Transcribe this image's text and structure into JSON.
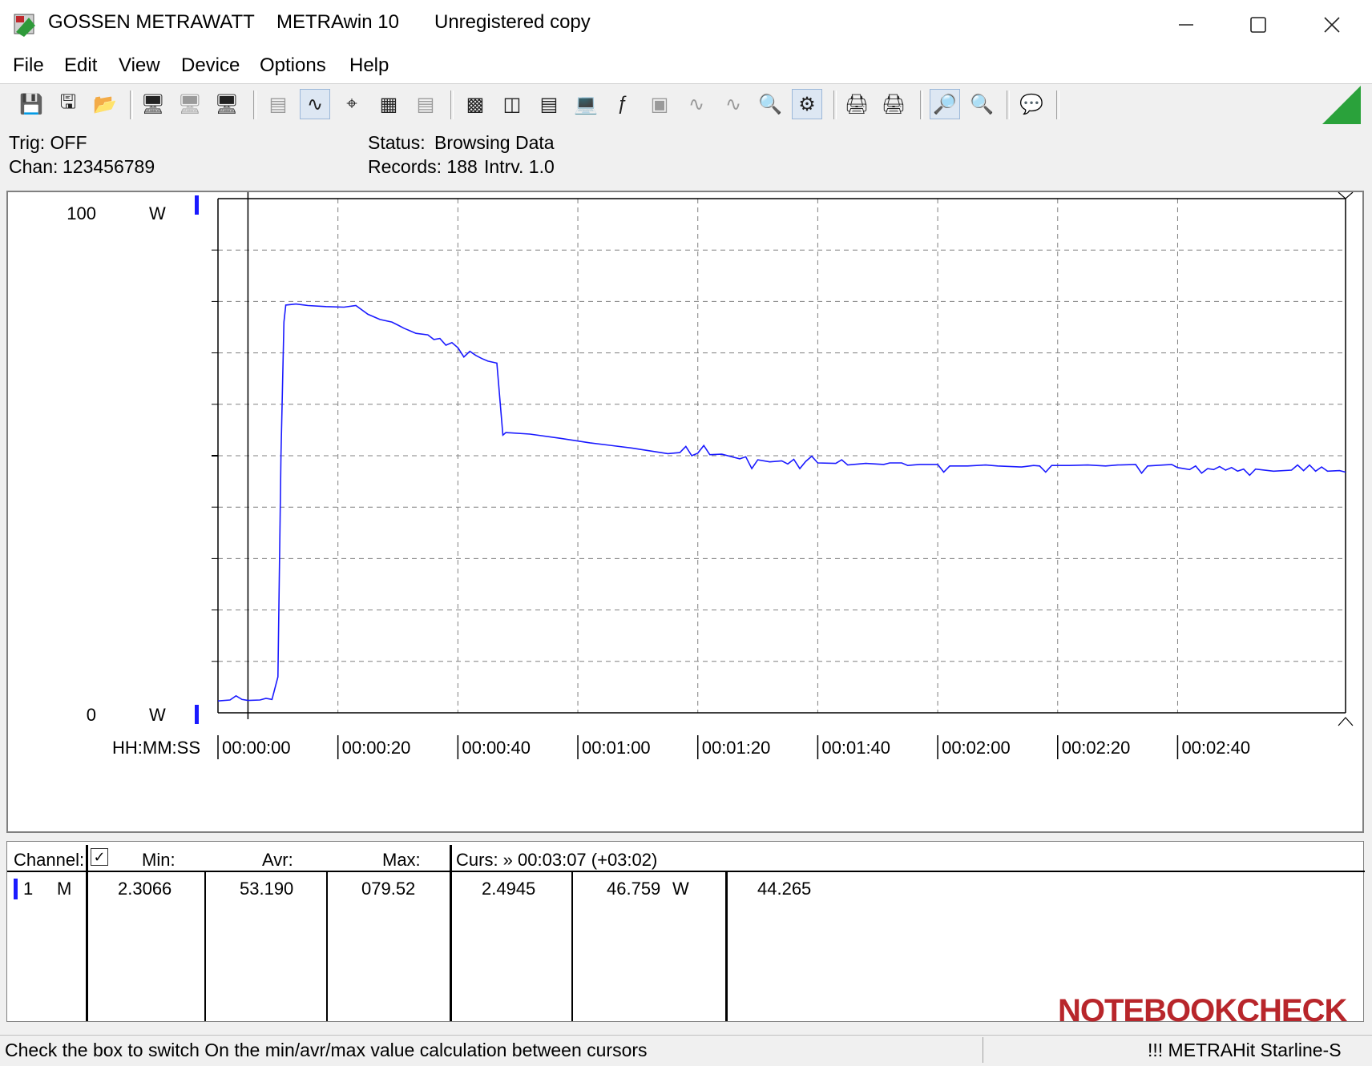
{
  "window": {
    "brand": "GOSSEN METRAWATT",
    "app": "METRAwin 10",
    "license": "Unregistered copy"
  },
  "menu": [
    "File",
    "Edit",
    "View",
    "Device",
    "Options",
    "Help"
  ],
  "info": {
    "trig": "Trig: OFF",
    "chan_label": "Chan:",
    "chan_value": "123456789",
    "status_label": "Status:",
    "status_value": "Browsing Data",
    "records": "Records: 188",
    "interval": "Intrv. 1.0"
  },
  "chart_data": {
    "type": "line",
    "xlabel": "HH:MM:SS",
    "y_top_label": "100",
    "y_bottom_label": "0",
    "y_unit": "W",
    "ylim": [
      0,
      100
    ],
    "xlim_seconds": [
      0,
      188
    ],
    "x_tick_labels": [
      "00:00:00",
      "00:00:20",
      "00:00:40",
      "00:01:00",
      "00:01:20",
      "00:01:40",
      "00:02:00",
      "00:02:20",
      "00:02:40"
    ],
    "grid": true,
    "grid_style": "dashed",
    "line_color": "#1a1aff",
    "cursor_line_seconds": 5,
    "series": [
      {
        "points": [
          [
            0,
            2.3
          ],
          [
            2,
            2.5
          ],
          [
            3,
            3.3
          ],
          [
            4,
            2.6
          ],
          [
            5,
            2.4
          ],
          [
            7,
            2.5
          ],
          [
            8,
            2.8
          ],
          [
            9,
            2.6
          ],
          [
            10,
            7
          ],
          [
            10.5,
            50
          ],
          [
            11,
            76
          ],
          [
            11.3,
            79.3
          ],
          [
            13,
            79.5
          ],
          [
            15,
            79.2
          ],
          [
            18,
            79.0
          ],
          [
            21,
            78.9
          ],
          [
            23,
            79.2
          ],
          [
            25,
            77.5
          ],
          [
            27,
            76.5
          ],
          [
            29,
            76
          ],
          [
            30,
            75.4
          ],
          [
            31,
            74.8
          ],
          [
            33,
            73.8
          ],
          [
            35,
            73.5
          ],
          [
            36,
            72.6
          ],
          [
            37,
            72.8
          ],
          [
            38,
            71.5
          ],
          [
            39,
            72
          ],
          [
            40,
            71
          ],
          [
            41,
            69.2
          ],
          [
            42,
            70.3
          ],
          [
            43,
            69.5
          ],
          [
            44,
            68.9
          ],
          [
            45,
            68.4
          ],
          [
            46.5,
            68
          ],
          [
            47.5,
            54
          ],
          [
            48,
            54.5
          ],
          [
            52,
            54.2
          ],
          [
            57,
            53.4
          ],
          [
            62,
            52.5
          ],
          [
            69,
            51.5
          ],
          [
            75,
            50.4
          ],
          [
            77,
            50.6
          ],
          [
            78,
            51.8
          ],
          [
            79,
            50
          ],
          [
            80,
            50.5
          ],
          [
            81,
            52
          ],
          [
            82,
            50.2
          ],
          [
            84,
            50.3
          ],
          [
            87,
            49.4
          ],
          [
            88,
            49.8
          ],
          [
            89,
            47.5
          ],
          [
            90,
            49.2
          ],
          [
            92,
            48.8
          ],
          [
            94,
            49
          ],
          [
            95,
            48.4
          ],
          [
            96,
            49.3
          ],
          [
            97,
            47.5
          ],
          [
            98,
            48.9
          ],
          [
            99,
            49.9
          ],
          [
            100,
            48.6
          ],
          [
            103,
            48.5
          ],
          [
            104,
            49.2
          ],
          [
            105,
            48.2
          ],
          [
            108,
            48.5
          ],
          [
            111,
            48.3
          ],
          [
            112,
            48.6
          ],
          [
            114,
            48.6
          ],
          [
            115,
            48.1
          ],
          [
            117,
            48.3
          ],
          [
            120,
            48.3
          ],
          [
            121,
            46.8
          ],
          [
            122,
            48.0
          ],
          [
            125,
            48
          ],
          [
            128,
            48.2
          ],
          [
            130,
            48
          ],
          [
            134,
            47.8
          ],
          [
            136,
            48.1
          ],
          [
            137,
            48.0
          ],
          [
            138,
            46.8
          ],
          [
            139,
            48.1
          ],
          [
            142,
            48.1
          ],
          [
            145,
            48.2
          ],
          [
            148,
            48.0
          ],
          [
            150,
            48.2
          ],
          [
            153,
            48.3
          ],
          [
            154,
            46.6
          ],
          [
            155,
            48.0
          ],
          [
            159,
            48.3
          ],
          [
            160,
            47.7
          ],
          [
            162,
            47.3
          ],
          [
            163,
            48.0
          ],
          [
            164,
            46.6
          ],
          [
            165,
            47.5
          ],
          [
            166,
            47.3
          ],
          [
            167,
            47.9
          ],
          [
            168,
            47.2
          ],
          [
            169,
            47.7
          ],
          [
            170,
            47.0
          ],
          [
            171,
            47.4
          ],
          [
            172,
            46.2
          ],
          [
            173,
            47.4
          ],
          [
            176,
            47.0
          ],
          [
            179,
            47.2
          ],
          [
            180,
            48.2
          ],
          [
            181,
            47.1
          ],
          [
            182,
            48.2
          ],
          [
            183,
            47.0
          ],
          [
            184,
            47.8
          ],
          [
            185,
            47.0
          ],
          [
            187,
            47.1
          ],
          [
            188,
            46.8
          ]
        ]
      }
    ]
  },
  "table": {
    "headers": {
      "channel": "Channel:",
      "min": "Min:",
      "avr": "Avr:",
      "max": "Max:",
      "cursor": "Curs: » 00:03:07 (+03:02)"
    },
    "row": {
      "num": "1",
      "mode": "M",
      "min": "2.3066",
      "avr": "53.190",
      "max": "079.52",
      "curs1": "2.4945",
      "curs2": "46.759",
      "unit": "W",
      "curs3": "44.265"
    }
  },
  "statusbar": {
    "hint": "Check the box to switch On the min/avr/max value calculation between cursors",
    "device": "!!! METRAHit Starline-S"
  },
  "watermark": "NOTEBOOKCHECK",
  "toolbar_icons": [
    "save-icon",
    "save-as-icon",
    "open-icon",
    "device-read-icon",
    "device-settings-icon",
    "device-memory-icon",
    "print-preview-icon",
    "zoom-fit-icon",
    "crosshair-icon",
    "table-icon",
    "list-icon",
    "layout-icon",
    "export-icon",
    "chart-table-icon",
    "monitor-icon",
    "function-icon",
    "screen-icon",
    "waveform-icon",
    "signal-icon",
    "search-icon",
    "trigger-icon",
    "print-icon",
    "print-setup-icon",
    "zoom-in-icon",
    "zoom-out-icon",
    "comment-icon"
  ],
  "colors": {
    "accent": "#1a1aff",
    "grid": "#808080",
    "indicator": "#1f9f3a"
  }
}
